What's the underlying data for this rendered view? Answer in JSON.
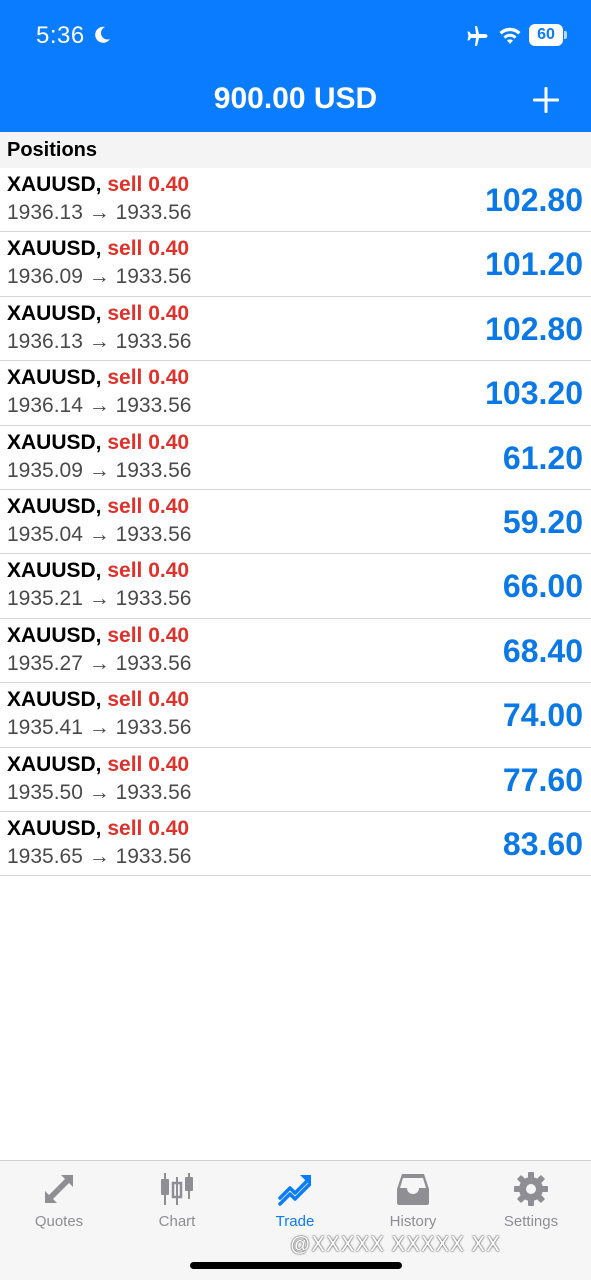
{
  "status_bar": {
    "time": "5:36",
    "battery": "60",
    "icons": [
      "moon-icon",
      "airplane-icon",
      "wifi-icon",
      "battery-icon"
    ]
  },
  "header": {
    "title": "900.00 USD",
    "add_icon": "plus-icon"
  },
  "section": {
    "title": "Positions"
  },
  "positions": [
    {
      "symbol": "XAUUSD,",
      "side": "sell 0.40",
      "prices": "1936.13 → 1933.56",
      "profit": "102.80"
    },
    {
      "symbol": "XAUUSD,",
      "side": "sell 0.40",
      "prices": "1936.09 → 1933.56",
      "profit": "101.20"
    },
    {
      "symbol": "XAUUSD,",
      "side": "sell 0.40",
      "prices": "1936.13 → 1933.56",
      "profit": "102.80"
    },
    {
      "symbol": "XAUUSD,",
      "side": "sell 0.40",
      "prices": "1936.14 → 1933.56",
      "profit": "103.20"
    },
    {
      "symbol": "XAUUSD,",
      "side": "sell 0.40",
      "prices": "1935.09 → 1933.56",
      "profit": "61.20"
    },
    {
      "symbol": "XAUUSD,",
      "side": "sell 0.40",
      "prices": "1935.04 → 1933.56",
      "profit": "59.20"
    },
    {
      "symbol": "XAUUSD,",
      "side": "sell 0.40",
      "prices": "1935.21 → 1933.56",
      "profit": "66.00"
    },
    {
      "symbol": "XAUUSD,",
      "side": "sell 0.40",
      "prices": "1935.27 → 1933.56",
      "profit": "68.40"
    },
    {
      "symbol": "XAUUSD,",
      "side": "sell 0.40",
      "prices": "1935.41 → 1933.56",
      "profit": "74.00"
    },
    {
      "symbol": "XAUUSD,",
      "side": "sell 0.40",
      "prices": "1935.50 → 1933.56",
      "profit": "77.60"
    },
    {
      "symbol": "XAUUSD,",
      "side": "sell 0.40",
      "prices": "1935.65 → 1933.56",
      "profit": "83.60"
    }
  ],
  "tabs": [
    {
      "label": "Quotes",
      "icon": "quotes-arrows-icon",
      "active": false
    },
    {
      "label": "Chart",
      "icon": "candlestick-icon",
      "active": false
    },
    {
      "label": "Trade",
      "icon": "trend-up-icon",
      "active": true
    },
    {
      "label": "History",
      "icon": "inbox-tray-icon",
      "active": false
    },
    {
      "label": "Settings",
      "icon": "gear-icon",
      "active": false
    }
  ],
  "watermark": "@ⅩⅩⅩⅩⅩ ⅩⅩⅩⅩⅩ ⅩⅩ",
  "colors": {
    "header_blue": "#0a7cff",
    "sell_red": "#e0322b",
    "profit_blue": "#0a78e6",
    "inactive_gray": "#8e8e93"
  }
}
